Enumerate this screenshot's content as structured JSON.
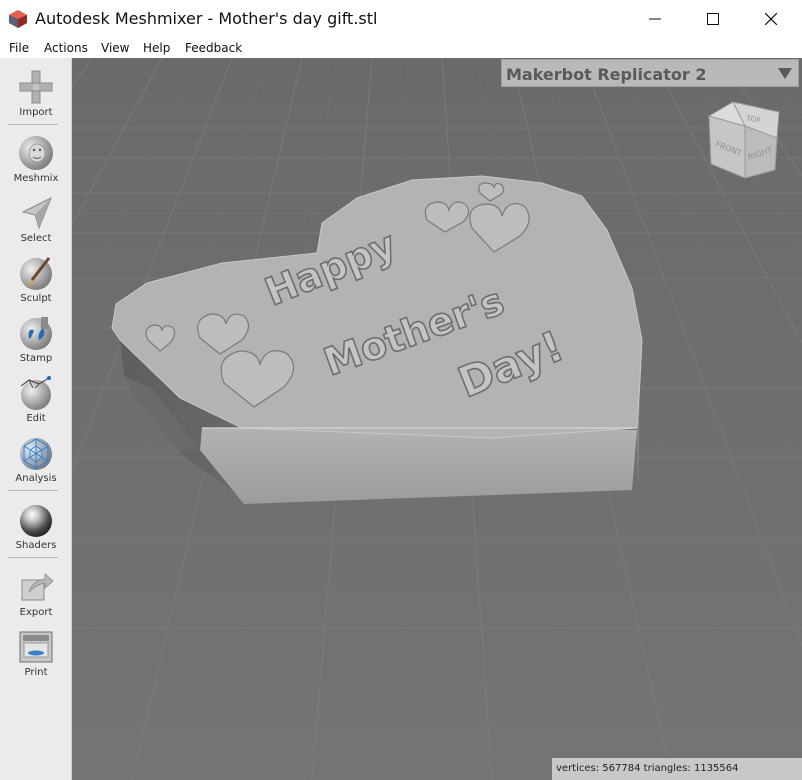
{
  "window": {
    "title": "Autodesk Meshmixer - Mother's day gift.stl"
  },
  "menu": [
    "File",
    "Actions",
    "View",
    "Help",
    "Feedback"
  ],
  "tools": [
    {
      "label": "Import",
      "icon": "plus-icon"
    },
    {
      "label": "Meshmix",
      "icon": "bunny-sphere-icon"
    },
    {
      "label": "Select",
      "icon": "arrow-select-icon"
    },
    {
      "label": "Sculpt",
      "icon": "brush-sphere-icon"
    },
    {
      "label": "Stamp",
      "icon": "stamp-sphere-icon"
    },
    {
      "label": "Edit",
      "icon": "edit-sphere-icon"
    },
    {
      "label": "Analysis",
      "icon": "analysis-sphere-icon"
    },
    {
      "label": "Shaders",
      "icon": "shader-sphere-icon"
    },
    {
      "label": "Export",
      "icon": "export-icon"
    },
    {
      "label": "Print",
      "icon": "printer-icon"
    }
  ],
  "printer": {
    "label": "Makerbot Replicator 2"
  },
  "viewcube": {
    "top": "TOP",
    "front": "FRONT",
    "right": "RIGHT"
  },
  "model": {
    "line1": "Happy",
    "line2": "Mother's",
    "line3": "Day!"
  },
  "status": {
    "vertices_label": "vertices:",
    "vertices": "567784",
    "triangles_label": "triangles:",
    "triangles": "1135564"
  },
  "colors": {
    "viewport": "#6e6e6e",
    "grid": "#7c7c7c",
    "model_top": "#b4b4b4",
    "model_side": "#9a9a9a"
  }
}
